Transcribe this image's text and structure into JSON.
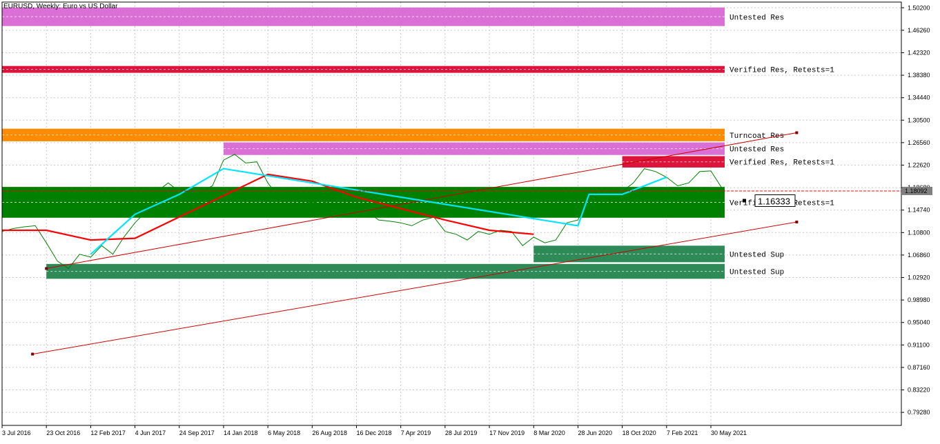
{
  "chart_title": "EURUSD, Weekly:  Euro vs US Dollar",
  "price_axis_labels": [
    "1.50200",
    "1.46260",
    "1.42320",
    "1.38380",
    "1.34440",
    "1.30500",
    "1.26560",
    "1.22620",
    "1.18680",
    "1.14740",
    "1.10800",
    "1.06860",
    "1.02920",
    "0.98980",
    "0.95040",
    "0.91100",
    "0.87160",
    "0.83220",
    "0.79280"
  ],
  "time_axis_labels": [
    "3 Jul 2016",
    "23 Oct 2016",
    "12 Feb 2017",
    "4 Jun 2017",
    "24 Sep 2017",
    "14 Jan 2018",
    "6 May 2018",
    "26 Aug 2018",
    "16 Dec 2018",
    "7 Apr 2019",
    "28 Jul 2019",
    "17 Nov 2019",
    "8 Mar 2020",
    "28 Jun 2020",
    "18 Oct 2020",
    "7 Feb 2021",
    "30 May 2021"
  ],
  "current_price_tag": "1.18092",
  "cursor_price_label": "1.16333",
  "zones": [
    {
      "label": "Untested Res",
      "color": "#da70d6",
      "price_top": 1.5025,
      "price_bottom": 1.47,
      "date_start": "3 Jul 2016",
      "date_end": "30 May 2021"
    },
    {
      "label": "Verified Res, Retests=1",
      "color": "#dc143c",
      "price_top": 1.4,
      "price_bottom": 1.388,
      "date_start": "3 Jul 2016",
      "date_end": "30 May 2021"
    },
    {
      "label": "Turncoat Res",
      "color": "#ff8c00",
      "price_top": 1.29,
      "price_bottom": 1.268,
      "date_start": "3 Jul 2016",
      "date_end": "30 May 2021"
    },
    {
      "label": "Untested Res",
      "color": "#da70d6",
      "price_top": 1.266,
      "price_bottom": 1.244,
      "date_start": "14 Jan 2018",
      "date_end": "30 May 2021"
    },
    {
      "label": "Verified Res, Retests=1",
      "color": "#dc143c",
      "price_top": 1.242,
      "price_bottom": 1.222,
      "date_start": "18 Oct 2020",
      "date_end": "30 May 2021"
    },
    {
      "label": "Verified Sup, Retests=1",
      "color": "#008000",
      "price_top": 1.188,
      "price_bottom": 1.134,
      "date_start": "3 Jul 2016",
      "date_end": "30 May 2021"
    },
    {
      "label": "Untested Sup",
      "color": "#2e8b57",
      "price_top": 1.085,
      "price_bottom": 1.056,
      "date_start": "8 Mar 2020",
      "date_end": "30 May 2021"
    },
    {
      "label": "Untested Sup",
      "color": "#2e8b57",
      "price_top": 1.053,
      "price_bottom": 1.027,
      "date_start": "23 Oct 2016",
      "date_end": "30 May 2021"
    }
  ],
  "chart_data": {
    "type": "line",
    "symbol": "EURUSD",
    "timeframe": "Weekly",
    "y_range": [
      0.77,
      1.512
    ],
    "series": [
      {
        "name": "",
        "color": "#008000",
        "kind": "price-close",
        "points": [
          [
            "3 Jul 2016",
            1.11
          ],
          [
            "31 Jul 2016",
            1.115
          ],
          [
            "28 Aug 2016",
            1.118
          ],
          [
            "25 Sep 2016",
            1.12
          ],
          [
            "23 Oct 2016",
            1.09
          ],
          [
            "20 Nov 2016",
            1.058
          ],
          [
            "18 Dec 2016",
            1.045
          ],
          [
            "15 Jan 2017",
            1.07
          ],
          [
            "12 Feb 2017",
            1.065
          ],
          [
            "12 Mar 2017",
            1.085
          ],
          [
            "9 Apr 2017",
            1.07
          ],
          [
            "7 May 2017",
            1.1
          ],
          [
            "4 Jun 2017",
            1.125
          ],
          [
            "2 Jul 2017",
            1.145
          ],
          [
            "30 Jul 2017",
            1.18
          ],
          [
            "27 Aug 2017",
            1.195
          ],
          [
            "24 Sep 2017",
            1.18
          ],
          [
            "22 Oct 2017",
            1.165
          ],
          [
            "19 Nov 2017",
            1.18
          ],
          [
            "17 Dec 2017",
            1.19
          ],
          [
            "14 Jan 2018",
            1.235
          ],
          [
            "11 Feb 2018",
            1.245
          ],
          [
            "11 Mar 2018",
            1.23
          ],
          [
            "8 Apr 2018",
            1.232
          ],
          [
            "6 May 2018",
            1.195
          ],
          [
            "3 Jun 2018",
            1.17
          ],
          [
            "1 Jul 2018",
            1.168
          ],
          [
            "29 Jul 2018",
            1.165
          ],
          [
            "26 Aug 2018",
            1.16
          ],
          [
            "23 Sep 2018",
            1.165
          ],
          [
            "21 Oct 2018",
            1.145
          ],
          [
            "18 Nov 2018",
            1.135
          ],
          [
            "16 Dec 2018",
            1.14
          ],
          [
            "13 Jan 2019",
            1.145
          ],
          [
            "10 Feb 2019",
            1.13
          ],
          [
            "10 Mar 2019",
            1.128
          ],
          [
            "7 Apr 2019",
            1.125
          ],
          [
            "5 May 2019",
            1.12
          ],
          [
            "2 Jun 2019",
            1.13
          ],
          [
            "30 Jun 2019",
            1.135
          ],
          [
            "28 Jul 2019",
            1.11
          ],
          [
            "25 Aug 2019",
            1.105
          ],
          [
            "22 Sep 2019",
            1.095
          ],
          [
            "20 Oct 2019",
            1.11
          ],
          [
            "17 Nov 2019",
            1.105
          ],
          [
            "15 Dec 2019",
            1.112
          ],
          [
            "12 Jan 2020",
            1.11
          ],
          [
            "9 Feb 2020",
            1.085
          ],
          [
            "8 Mar 2020",
            1.1
          ],
          [
            "5 Apr 2020",
            1.09
          ],
          [
            "3 May 2020",
            1.095
          ],
          [
            "31 May 2020",
            1.125
          ],
          [
            "28 Jun 2020",
            1.13
          ],
          [
            "26 Jul 2020",
            1.175
          ],
          [
            "23 Aug 2020",
            1.185
          ],
          [
            "20 Sep 2020",
            1.17
          ],
          [
            "18 Oct 2020",
            1.18
          ],
          [
            "15 Nov 2020",
            1.195
          ],
          [
            "13 Dec 2020",
            1.22
          ],
          [
            "10 Jan 2021",
            1.215
          ],
          [
            "7 Feb 2021",
            1.205
          ],
          [
            "7 Mar 2021",
            1.19
          ],
          [
            "4 Apr 2021",
            1.195
          ],
          [
            "2 May 2021",
            1.215
          ],
          [
            "30 May 2021",
            1.216
          ],
          [
            "27 Jun 2021",
            1.186
          ],
          [
            "4 Jul 2021",
            1.181
          ]
        ]
      },
      {
        "name": "",
        "color": "#cc0000",
        "kind": "trend-line",
        "points": [
          [
            "23 Oct 2016",
            1.045
          ],
          [
            "2 Jan 2022",
            1.283
          ]
        ]
      },
      {
        "name": "",
        "color": "#cc0000",
        "kind": "trend-line",
        "points": [
          [
            "18 Sep 2016",
            0.895
          ],
          [
            "2 Jan 2022",
            1.1265
          ]
        ]
      },
      {
        "name": "",
        "color": "#ff0000",
        "kind": "ma",
        "points": [
          [
            "3 Jul 2016",
            1.112
          ],
          [
            "23 Oct 2016",
            1.112
          ],
          [
            "12 Feb 2017",
            1.095
          ],
          [
            "4 Jun 2017",
            1.098
          ],
          [
            "6 May 2018",
            1.21
          ],
          [
            "26 Aug 2018",
            1.198
          ],
          [
            "16 Dec 2018",
            1.17
          ],
          [
            "28 Jul 2019",
            1.13
          ],
          [
            "17 Nov 2019",
            1.112
          ],
          [
            "8 Mar 2020",
            1.105
          ]
        ]
      },
      {
        "name": "",
        "color": "#00e5ff",
        "kind": "ma",
        "points": [
          [
            "12 Feb 2017",
            1.07
          ],
          [
            "4 Jun 2017",
            1.14
          ],
          [
            "24 Sep 2017",
            1.175
          ],
          [
            "14 Jan 2018",
            1.22
          ],
          [
            "28 Jun 2020",
            1.12
          ],
          [
            "26 Jul 2020",
            1.175
          ],
          [
            "18 Oct 2020",
            1.175
          ],
          [
            "7 Feb 2021",
            1.205
          ]
        ]
      }
    ]
  }
}
